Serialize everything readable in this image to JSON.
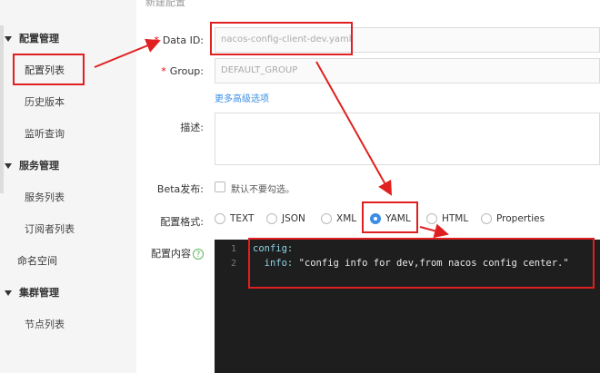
{
  "sidebar": {
    "groups": [
      {
        "label": "配置管理"
      },
      {
        "label": "服务管理"
      },
      {
        "label": "集群管理"
      }
    ],
    "items": [
      {
        "label": "配置列表"
      },
      {
        "label": "历史版本"
      },
      {
        "label": "监听查询"
      },
      {
        "label": "服务列表"
      },
      {
        "label": "订阅者列表"
      },
      {
        "label": "命名空间"
      },
      {
        "label": "节点列表"
      }
    ]
  },
  "header": {
    "cut_title": "新建配置"
  },
  "form": {
    "data_id_label": "Data ID:",
    "data_id_value": "nacos-config-client-dev.yaml",
    "group_label": "Group:",
    "group_value": "DEFAULT_GROUP",
    "advanced_link": "更多高级选项",
    "desc_label": "描述:",
    "beta_label": "Beta发布:",
    "beta_hint": "默认不要勾选。",
    "format_label": "配置格式:",
    "formats": [
      "TEXT",
      "JSON",
      "XML",
      "YAML",
      "HTML",
      "Properties"
    ],
    "selected_format": "YAML",
    "content_label": "配置内容",
    "help_glyph": "?"
  },
  "editor": {
    "lines": [
      {
        "num": "1",
        "key": "config:",
        "value": ""
      },
      {
        "num": "2",
        "key": "  info:",
        "value": " \"config info for dev,from nacos config center.\""
      }
    ]
  },
  "annotation_color": "#e02020",
  "accent_color": "#3a8ee6"
}
